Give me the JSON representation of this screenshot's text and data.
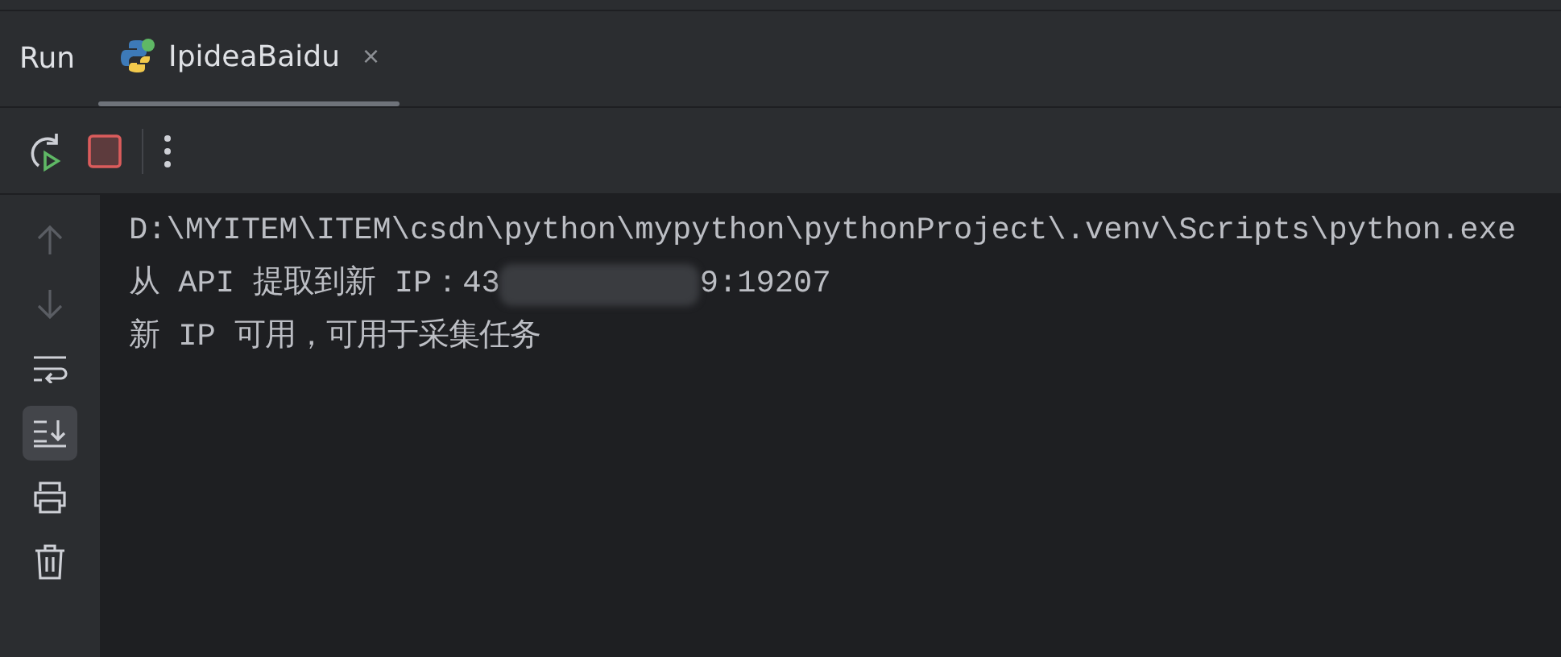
{
  "panel_title": "Run",
  "tabs": [
    {
      "label": "IpideaBaidu",
      "selected": true,
      "close_glyph": "×"
    }
  ],
  "toolbar": {
    "stop_enabled": true
  },
  "gutter_actions": [
    {
      "kind": "up",
      "disabled": true,
      "selected": false
    },
    {
      "kind": "down",
      "disabled": true,
      "selected": false
    },
    {
      "kind": "wrap",
      "disabled": false,
      "selected": false
    },
    {
      "kind": "scroll-end",
      "disabled": false,
      "selected": true
    },
    {
      "kind": "print",
      "disabled": false,
      "selected": false
    },
    {
      "kind": "clear",
      "disabled": false,
      "selected": false
    }
  ],
  "console_lines": [
    {
      "text": "D:\\MYITEM\\ITEM\\csdn\\python\\mypython\\pythonProject\\.venv\\Scripts\\python.exe"
    },
    {
      "text": "从 API 提取到新 IP：43",
      "redacted": true,
      "text_after": "9:19207"
    },
    {
      "text": "新 IP 可用，可用于采集任务"
    }
  ]
}
